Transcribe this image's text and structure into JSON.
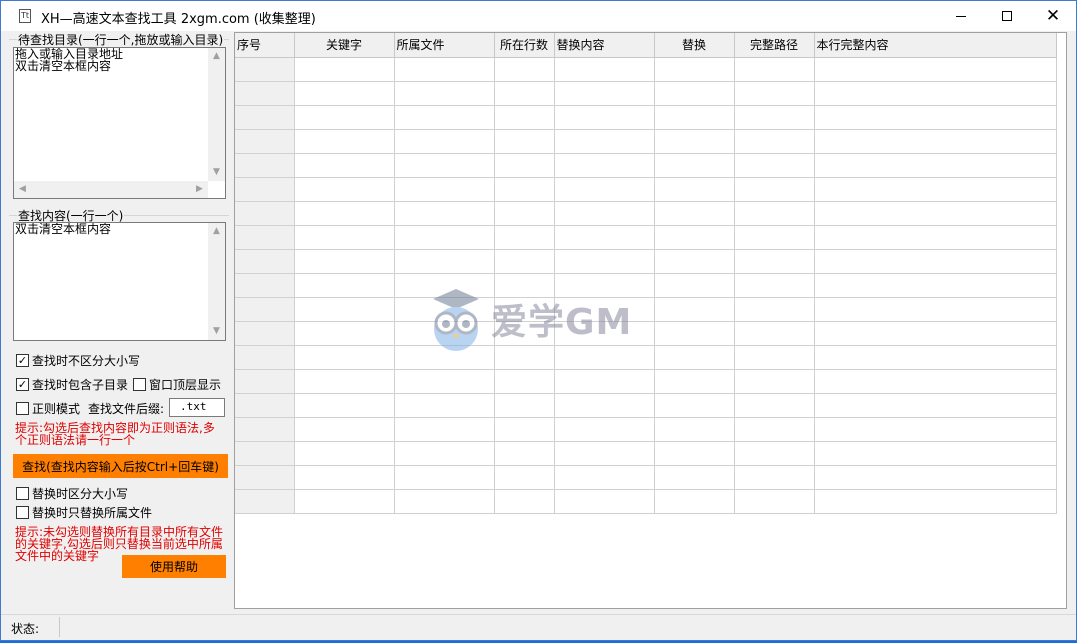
{
  "window": {
    "app_icon_glyph": "Tt",
    "title": "XH—高速文本查找工具 2xgm.com (收集整理)",
    "minimize_glyph": "",
    "maximize_glyph": "",
    "close_glyph": "✕"
  },
  "dir_group": {
    "label": "待查找目录(一行一个,拖放或输入目录)",
    "text": "拖入或输入目录地址\n双击清空本框内容"
  },
  "content_group": {
    "label": "查找内容(一行一个)",
    "text": "双击清空本框内容"
  },
  "options": {
    "case_insensitive": {
      "label": "查找时不区分大小写",
      "checked": true
    },
    "include_subdirs": {
      "label": "查找时包含子目录",
      "checked": true
    },
    "window_topmost": {
      "label": "窗口顶层显示",
      "checked": false
    },
    "regex_mode": {
      "label": "正则模式",
      "checked": false
    },
    "suffix_label": "查找文件后缀:",
    "suffix_value": ".txt"
  },
  "hint_regex": "提示:勾选后查找内容即为正则语法,多\n个正则语法请一行一个",
  "search_button": "查找(查找内容输入后按Ctrl+回车键)",
  "replace_options": {
    "replace_case_sensitive": {
      "label": "替换时区分大小写",
      "checked": false
    },
    "replace_only_belonging": {
      "label": "替换时只替换所属文件",
      "checked": false
    }
  },
  "hint_replace": "提示:未勾选则替换所有目录中所有文件\n的关键字,勾选后则只替换当前选中所属\n文件中的关键字",
  "help_button": "使用帮助",
  "grid": {
    "columns": [
      "序号",
      "关键字",
      "所属文件",
      "所在行数",
      "替换内容",
      "替换",
      "完整路径",
      "本行完整内容"
    ]
  },
  "watermark": {
    "text": "爱学GM"
  },
  "status": {
    "label": "状态:",
    "value": ""
  }
}
